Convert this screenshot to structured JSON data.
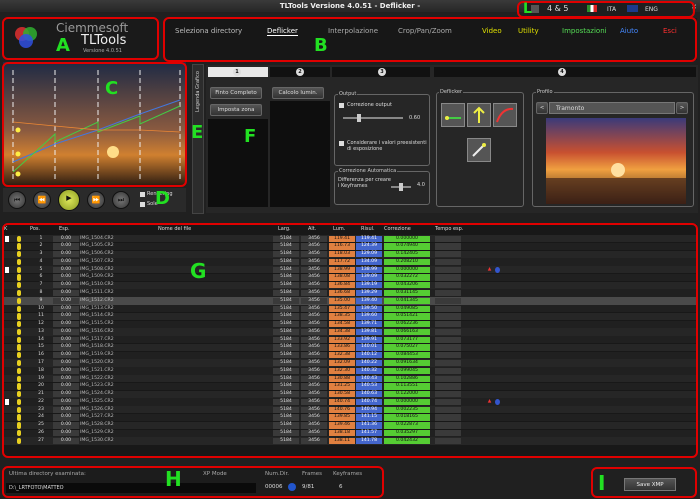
{
  "window": {
    "title": "TLTools Versione 4.0.51 - Deflicker -",
    "controls": "_ ▫ ✕"
  },
  "logo": {
    "brand_top": "Ciemmesoft",
    "brand_main": "TLTools",
    "version": "Versione 4.0.51"
  },
  "language": {
    "version_label": "4 & 5",
    "ita": "ITA",
    "eng": "ENG"
  },
  "menu": [
    {
      "label": "Seleziona directory",
      "color": "#bbbbbb"
    },
    {
      "label": "Deflicker",
      "color": "#ffffff"
    },
    {
      "label": "Interpolazione",
      "color": "#aaaaaa"
    },
    {
      "label": "Crop/Pan/Zoom",
      "color": "#aaaaaa"
    },
    {
      "label": "Video",
      "color": "#e0e000"
    },
    {
      "label": "Utility",
      "color": "#e0e000"
    },
    {
      "label": "Impostazioni",
      "color": "#55dd55"
    },
    {
      "label": "Aiuto",
      "color": "#4488ff"
    },
    {
      "label": "Esci",
      "color": "#ff3030"
    }
  ],
  "annotations": [
    "A",
    "B",
    "C",
    "D",
    "E",
    "F",
    "G",
    "H",
    "I",
    "L"
  ],
  "playback": {
    "rendering": "Rendering",
    "sole": "Sole"
  },
  "sidetab": {
    "label": "Legenda Grafico"
  },
  "steps": {
    "nums": [
      "1",
      "2",
      "3",
      "4"
    ],
    "btn_finto": "Finto Completo",
    "btn_imposta": "Imposta zona",
    "btn_calcolo": "Calcolo lumin.",
    "output_label": "Output",
    "correzione_output": "Correzione output",
    "output_value": "0.60",
    "considerare": "Considerare i valori preesistenti di esposizione",
    "correzione_auto": "Correzione Automatica",
    "differenza": "Differenza per creare i Keyframes",
    "diff_value": "4.0",
    "deflicker_label": "Deflicker",
    "profilo_label": "Profilo",
    "profilo_value": "Tramonto",
    "prev": "<",
    "next": ">"
  },
  "table": {
    "headers": {
      "k": "K",
      "pos": "Pos.",
      "esp": "Esp.",
      "nome": "Nome del file",
      "larg": "Larg.",
      "alt": "Alt.",
      "lum": "Lum.",
      "risul": "Risul.",
      "corr": "Correzione",
      "tempo": "Tempo esp."
    },
    "rows": [
      [
        "1",
        "0.00",
        "IMG_1504.CR2",
        "5184",
        "3456",
        "119.41",
        "119.41",
        "0.000000"
      ],
      [
        "2",
        "0.00",
        "IMG_1505.CR2",
        "5184",
        "3456",
        "116.73",
        "124.39",
        "0.074940"
      ],
      [
        "3",
        "0.00",
        "IMG_1506.CR2",
        "5184",
        "3456",
        "118.03",
        "129.09",
        "0.142405"
      ],
      [
        "4",
        "0.00",
        "IMG_1507.CR2",
        "5184",
        "3456",
        "117.72",
        "134.09",
        "0.208210"
      ],
      [
        "5",
        "0.00",
        "IMG_1508.CR2",
        "5184",
        "3456",
        "138.99",
        "138.99",
        "0.000000"
      ],
      [
        "6",
        "0.00",
        "IMG_1509.CR2",
        "5184",
        "3456",
        "138.08",
        "139.09",
        "0.032272"
      ],
      [
        "7",
        "0.00",
        "IMG_1510.CR2",
        "5184",
        "3456",
        "136.84",
        "139.19",
        "0.043206"
      ],
      [
        "8",
        "0.00",
        "IMG_1511.CR2",
        "5184",
        "3456",
        "136.68",
        "139.29",
        "0.031145"
      ],
      [
        "9",
        "0.00",
        "IMG_1512.CR2",
        "5184",
        "3456",
        "135.00",
        "139.40",
        "0.041345"
      ],
      [
        "10",
        "0.00",
        "IMG_1513.CR2",
        "5184",
        "3456",
        "135.47",
        "139.50",
        "0.049085"
      ],
      [
        "11",
        "0.00",
        "IMG_1514.CR2",
        "5184",
        "3456",
        "138.35",
        "139.60",
        "0.051421"
      ],
      [
        "12",
        "0.00",
        "IMG_1515.CR2",
        "5184",
        "3456",
        "134.58",
        "139.71",
        "0.062236"
      ],
      [
        "13",
        "0.00",
        "IMG_1516.CR2",
        "5184",
        "3456",
        "134.38",
        "139.81",
        "0.066163"
      ],
      [
        "14",
        "0.00",
        "IMG_1517.CR2",
        "5184",
        "3456",
        "133.92",
        "139.91",
        "0.073177"
      ],
      [
        "15",
        "0.00",
        "IMG_1518.CR2",
        "5184",
        "3456",
        "133.86",
        "140.01",
        "0.075027"
      ],
      [
        "16",
        "0.00",
        "IMG_1519.CR2",
        "5184",
        "3456",
        "132.38",
        "140.12",
        "0.084453"
      ],
      [
        "17",
        "0.00",
        "IMG_1520.CR2",
        "5184",
        "3456",
        "132.09",
        "140.22",
        "0.091634"
      ],
      [
        "18",
        "0.00",
        "IMG_1521.CR2",
        "5184",
        "3456",
        "132.30",
        "140.32",
        "0.099045"
      ],
      [
        "19",
        "0.00",
        "IMG_1522.CR2",
        "5184",
        "3456",
        "130.88",
        "140.43",
        "0.102886"
      ],
      [
        "20",
        "0.00",
        "IMG_1523.CR2",
        "5184",
        "3456",
        "131.25",
        "140.53",
        "0.113551"
      ],
      [
        "21",
        "0.00",
        "IMG_1524.CR2",
        "5184",
        "3456",
        "130.58",
        "140.63",
        "0.122000"
      ],
      [
        "22",
        "0.00",
        "IMG_1525.CR2",
        "5184",
        "3456",
        "140.74",
        "140.74",
        "0.000000"
      ],
      [
        "23",
        "0.00",
        "IMG_1526.CR2",
        "5184",
        "3456",
        "140.76",
        "140.94",
        "0.002235"
      ],
      [
        "24",
        "0.00",
        "IMG_1527.CR2",
        "5184",
        "3456",
        "139.85",
        "141.15",
        "0.018165"
      ],
      [
        "25",
        "0.00",
        "IMG_1528.CR2",
        "5184",
        "3456",
        "139.46",
        "141.36",
        "0.022873"
      ],
      [
        "26",
        "0.00",
        "IMG_1529.CR2",
        "5184",
        "3456",
        "138.18",
        "141.57",
        "0.035297"
      ],
      [
        "27",
        "0.00",
        "IMG_1530.CR2",
        "5184",
        "3456",
        "138.11",
        "141.78",
        "0.042432"
      ]
    ]
  },
  "footer": {
    "ultima_label": "Ultima directory esaminata:",
    "xp_mode": "XP Mode",
    "path": "D:\\_LRTFOTO\\MATTEO",
    "numdir_label": "Num.Dir.",
    "numdir_value": "00006",
    "frames_label": "Frames",
    "frames_value": "9/81",
    "keyframes_label": "Keyframes",
    "keyframes_value": "6"
  },
  "save_label": "Save XMP",
  "colors": {
    "annotation": "#e00000",
    "letter": "#22e022",
    "lum": "#e08040",
    "risul": "#4466cc",
    "corr": "#55cc33"
  }
}
